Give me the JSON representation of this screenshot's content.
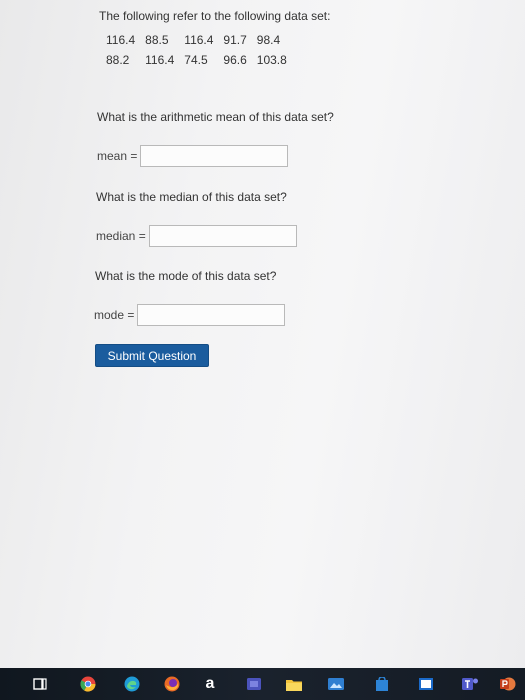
{
  "intro_text": "The following refer to the following data set:",
  "data_rows": [
    [
      "116.4",
      "88.5",
      "116.4",
      "91.7",
      "98.4"
    ],
    [
      "88.2",
      "116.4",
      "74.5",
      "96.6",
      "103.8"
    ]
  ],
  "questions": {
    "mean": {
      "question": "What is the arithmetic mean of this data set?",
      "label": "mean =",
      "value": ""
    },
    "median": {
      "question": "What is the median of this data set?",
      "label": "median =",
      "value": ""
    },
    "mode": {
      "question": "What is the mode of this data set?",
      "label": "mode =",
      "value": ""
    }
  },
  "submit_label": "Submit Question",
  "taskbar": {
    "amazon_glyph": "a",
    "icons": [
      "task-view-icon",
      "chrome-icon",
      "edge-icon",
      "firefox-icon",
      "amazon-icon",
      "teams-icon",
      "file-explorer-icon",
      "photos-icon",
      "store-icon",
      "mail-icon",
      "onenote-icon",
      "teams-t-icon",
      "powerpoint-icon"
    ]
  },
  "colors": {
    "submit_button": "#1a5c9e",
    "taskbar": "#141b24"
  }
}
